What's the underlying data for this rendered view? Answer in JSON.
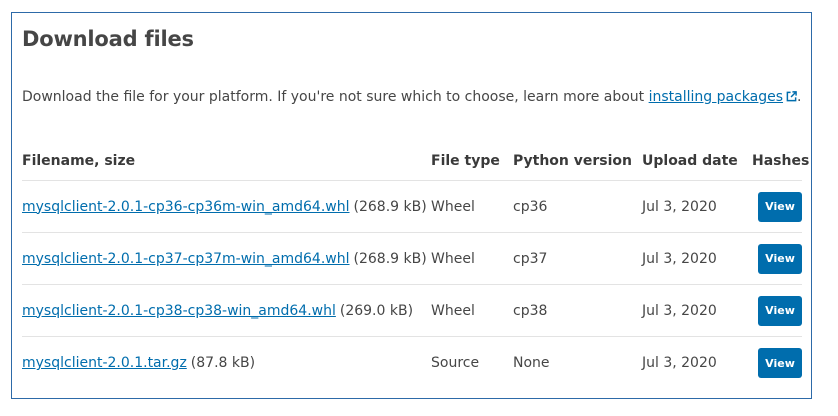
{
  "section": {
    "title": "Download files",
    "intro_text": "Download the file for your platform. If you're not sure which to choose, learn more about ",
    "intro_link": "installing packages",
    "intro_end": "."
  },
  "table": {
    "headers": {
      "filename": "Filename, size",
      "file_type": "File type",
      "python_version": "Python version",
      "upload_date": "Upload date",
      "hashes": "Hashes"
    },
    "rows": [
      {
        "filename": "mysqlclient-2.0.1-cp36-cp36m-win_amd64.whl",
        "size": "(268.9 kB)",
        "file_type": "Wheel",
        "python_version": "cp36",
        "upload_date": "Jul 3, 2020",
        "hash_button": "View"
      },
      {
        "filename": "mysqlclient-2.0.1-cp37-cp37m-win_amd64.whl",
        "size": "(268.9 kB)",
        "file_type": "Wheel",
        "python_version": "cp37",
        "upload_date": "Jul 3, 2020",
        "hash_button": "View"
      },
      {
        "filename": "mysqlclient-2.0.1-cp38-cp38-win_amd64.whl",
        "size": "(269.0 kB)",
        "file_type": "Wheel",
        "python_version": "cp38",
        "upload_date": "Jul 3, 2020",
        "hash_button": "View"
      },
      {
        "filename": "mysqlclient-2.0.1.tar.gz",
        "size": "(87.8 kB)",
        "file_type": "Source",
        "python_version": "None",
        "upload_date": "Jul 3, 2020",
        "hash_button": "View"
      }
    ]
  },
  "colors": {
    "link": "#006dad",
    "button": "#006dad",
    "border": "#2d6aa8",
    "text": "#464646"
  },
  "icons": {
    "external_link": "external-link-icon"
  }
}
